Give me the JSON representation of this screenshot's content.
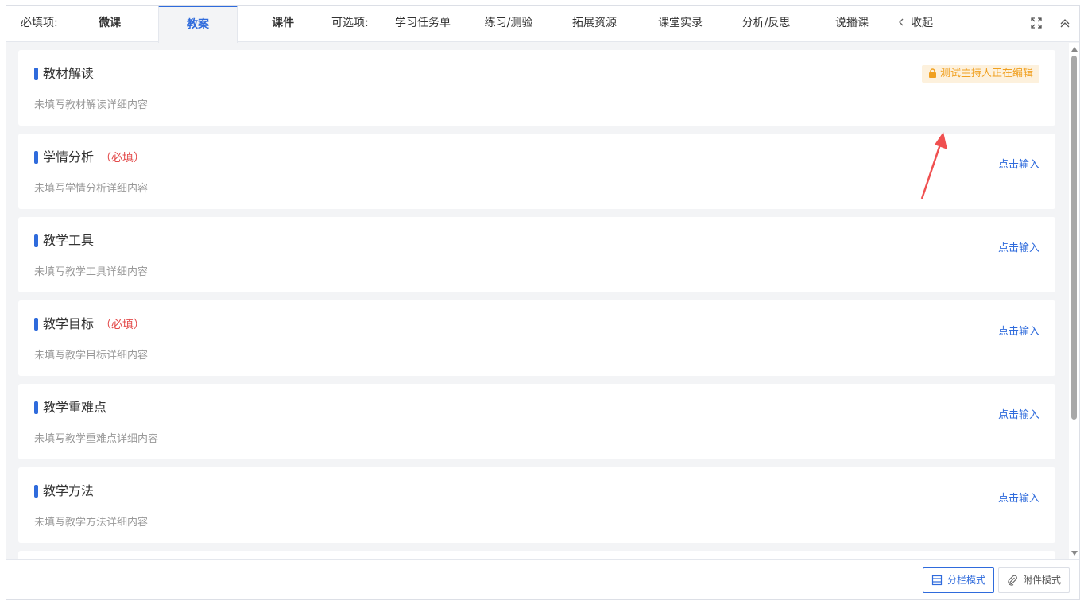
{
  "tabs": {
    "required_label": "必填项:",
    "required": [
      {
        "label": "微课"
      },
      {
        "label": "教案"
      },
      {
        "label": "课件"
      }
    ],
    "optional_label": "可选项:",
    "optional": [
      {
        "label": "学习任务单"
      },
      {
        "label": "练习/测验"
      },
      {
        "label": "拓展资源"
      },
      {
        "label": "课堂实录"
      },
      {
        "label": "分析/反思"
      },
      {
        "label": "说播课"
      }
    ],
    "collapse_label": "收起"
  },
  "sections": [
    {
      "title": "教材解读",
      "required_tag": "",
      "desc": "未填写教材解读详细内容",
      "lock_text": "测试主持人正在编辑"
    },
    {
      "title": "学情分析",
      "required_tag": "（必填）",
      "desc": "未填写学情分析详细内容",
      "action": "点击输入"
    },
    {
      "title": "教学工具",
      "required_tag": "",
      "desc": "未填写教学工具详细内容",
      "action": "点击输入"
    },
    {
      "title": "教学目标",
      "required_tag": "（必填）",
      "desc": "未填写教学目标详细内容",
      "action": "点击输入"
    },
    {
      "title": "教学重难点",
      "required_tag": "",
      "desc": "未填写教学重难点详细内容",
      "action": "点击输入"
    },
    {
      "title": "教学方法",
      "required_tag": "",
      "desc": "未填写教学方法详细内容",
      "action": "点击输入"
    }
  ],
  "footer": {
    "column_mode": "分栏模式",
    "attachment_mode": "附件模式"
  },
  "colors": {
    "accent": "#2f6bdc",
    "required": "#e34b4b",
    "lock_bg": "#fdf1dd",
    "lock_text": "#f0a020",
    "annotation_arrow": "#f05050"
  }
}
